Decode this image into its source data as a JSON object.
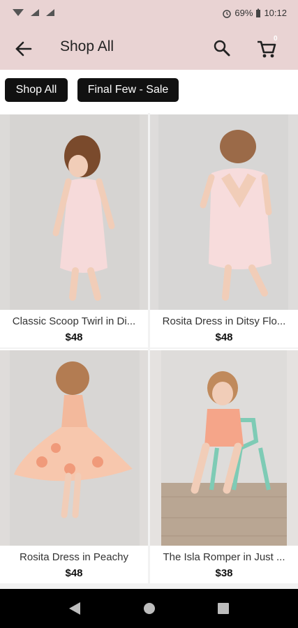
{
  "status": {
    "battery": "69%",
    "time": "10:12"
  },
  "header": {
    "title": "Shop All",
    "cart_count": "0"
  },
  "filters": [
    "Shop All",
    "Final Few - Sale"
  ],
  "products": [
    {
      "name": "Classic Scoop Twirl in Di...",
      "price": "$48"
    },
    {
      "name": "Rosita Dress in Ditsy Flo...",
      "price": "$48"
    },
    {
      "name": "Rosita Dress in Peachy",
      "price": "$48"
    },
    {
      "name": "The Isla Romper in Just ...",
      "price": "$38"
    }
  ],
  "colors": {
    "bar": "#e9d3d3",
    "chip": "#111111"
  }
}
